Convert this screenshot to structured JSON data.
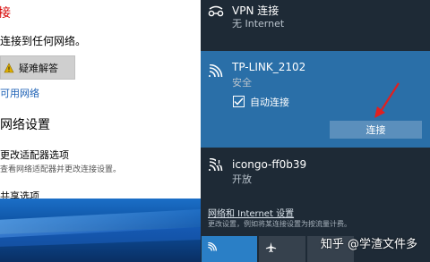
{
  "settings": {
    "no_connection": "接",
    "not_connected": "连接到任何网络。",
    "troubleshoot_label": "疑难解答",
    "available_networks_link": "可用网络",
    "network_settings_heading": "网络设置",
    "adapter_options_title": "更改适配器选项",
    "adapter_options_desc": "查看网络适配器并更改连接设置。",
    "sharing_options": "共享选项"
  },
  "flyout": {
    "vpn": {
      "title": "VPN 连接",
      "subtitle": "无 Internet"
    },
    "selected_network": {
      "name": "TP-LINK_2102",
      "security": "安全",
      "auto_connect_label": "自动连接",
      "auto_connect_checked": true,
      "connect_label": "连接"
    },
    "second_network": {
      "name": "icongo-ff0b39",
      "security": "开放"
    },
    "settings_link": "网络和 Internet 设置",
    "settings_desc": "更改设置，例如将某连接设置为按流量计费。"
  },
  "watermark": "知乎 @学渣文件多",
  "colors": {
    "flyout_bg": "#1e2a36",
    "selected_bg": "#2a6fa8",
    "connect_button": "#5b8fbc",
    "wifi_tile": "#2a7fc6",
    "error_red": "#d60000",
    "link_blue": "#1a5fb4"
  },
  "icons": {
    "vpn": "vpn-icon",
    "wifi": "wifi-icon",
    "wifi_open": "wifi-open-icon",
    "airplane": "airplane-icon",
    "warning": "warning-icon",
    "check": "checkmark-icon"
  }
}
